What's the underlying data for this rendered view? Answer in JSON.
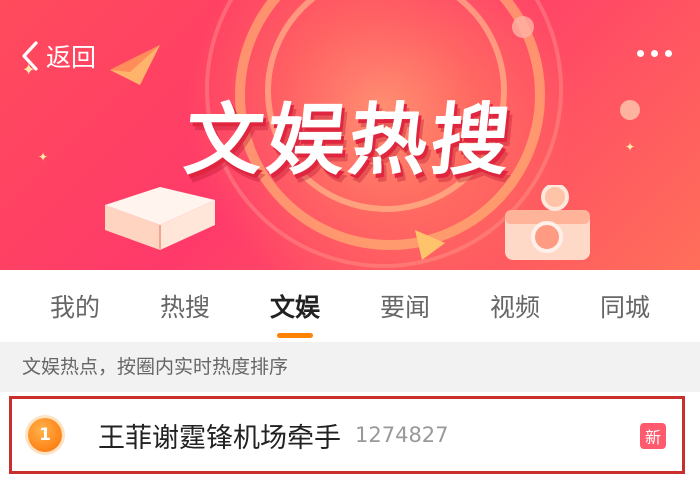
{
  "nav": {
    "back_label": "返回"
  },
  "banner": {
    "title": "文娱热搜"
  },
  "tabs": [
    {
      "label": "我的"
    },
    {
      "label": "热搜"
    },
    {
      "label": "文娱",
      "active": true
    },
    {
      "label": "要闻"
    },
    {
      "label": "视频"
    },
    {
      "label": "同城"
    }
  ],
  "subtitle": "文娱热点，按圈内实时热度排序",
  "list": [
    {
      "rank": "1",
      "title": "王菲谢霆锋机场牵手",
      "count": "1274827",
      "badge": "新"
    }
  ],
  "colors": {
    "accent": "#ff8200",
    "banner": "#ff4b5c",
    "highlight_border": "#c9302c",
    "badge_new": "#ff5a6d"
  }
}
